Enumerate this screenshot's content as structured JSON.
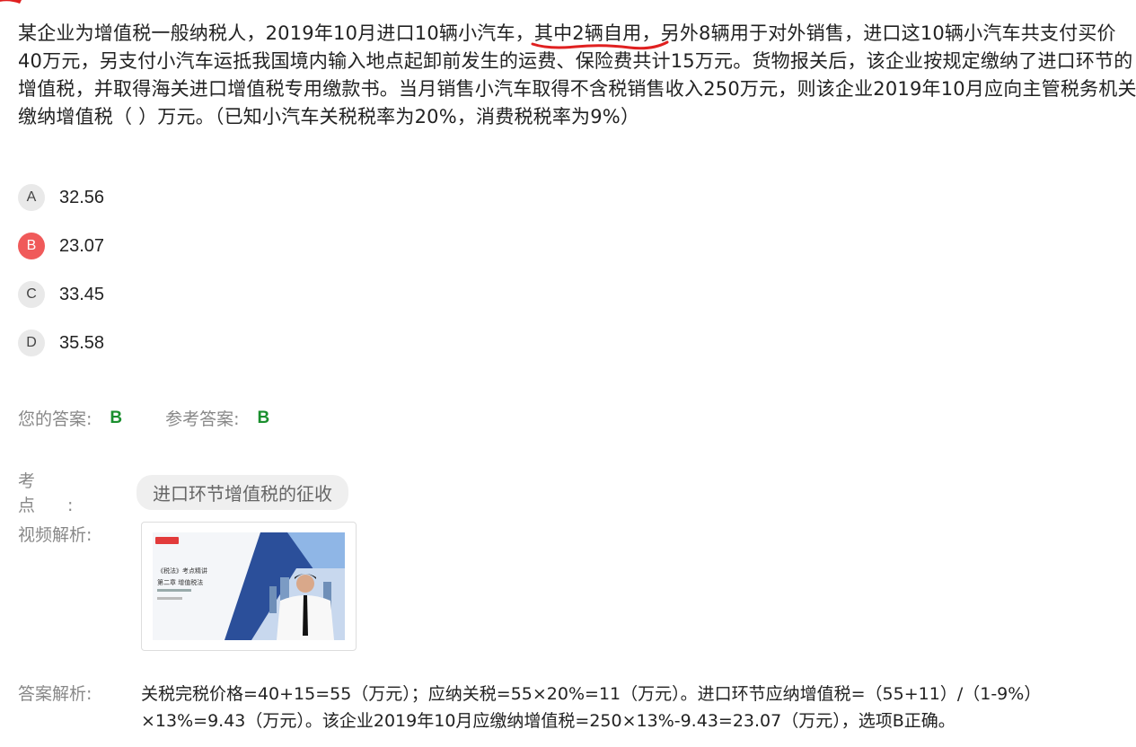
{
  "question": {
    "text_before": "某企业为增值税一般纳税人，2019年10月进口10辆小汽车，",
    "highlight": "其中2辆自用",
    "text_after": "，另外8辆用于对外销售，进口这10辆小汽车共支付买价40万元，另支付小汽车运抵我国境内输入地点起卸前发生的运费、保险费共计15万元。货物报关后，该企业按规定缴纳了进口环节的增值税，并取得海关进口增值税专用缴款书。当月销售小汽车取得不含税销售收入250万元，则该企业2019年10月应向主管税务机关缴纳增值税（ ）万元。（已知小汽车关税税率为20%，消费税税率为9%）"
  },
  "options": [
    {
      "letter": "A",
      "value": "32.56"
    },
    {
      "letter": "B",
      "value": "23.07",
      "selected": true
    },
    {
      "letter": "C",
      "value": "33.45"
    },
    {
      "letter": "D",
      "value": "35.58"
    }
  ],
  "answer": {
    "your_label": "您的答案:",
    "your_value": "B",
    "ref_label": "参考答案:",
    "ref_value": "B"
  },
  "knowledge_point": {
    "label": "考点:",
    "tag": "进口环节增值税的征收"
  },
  "video": {
    "label": "视频解析:",
    "thumb_title": "《税法》考点精讲",
    "thumb_chapter": "第二章 增值税法"
  },
  "analysis": {
    "label": "答案解析:",
    "text": "关税完税价格=40+15=55（万元）；应纳关税=55×20%=11（万元）。进口环节应纳增值税=（55+11）/（1-9%）×13%=9.43（万元）。该企业2019年10月应缴纳增值税=250×13%-9.43=23.07（万元），选项B正确。"
  },
  "colors": {
    "selected": "#f05a5a",
    "correct": "#1a8f2e",
    "annotation": "#e02020"
  }
}
